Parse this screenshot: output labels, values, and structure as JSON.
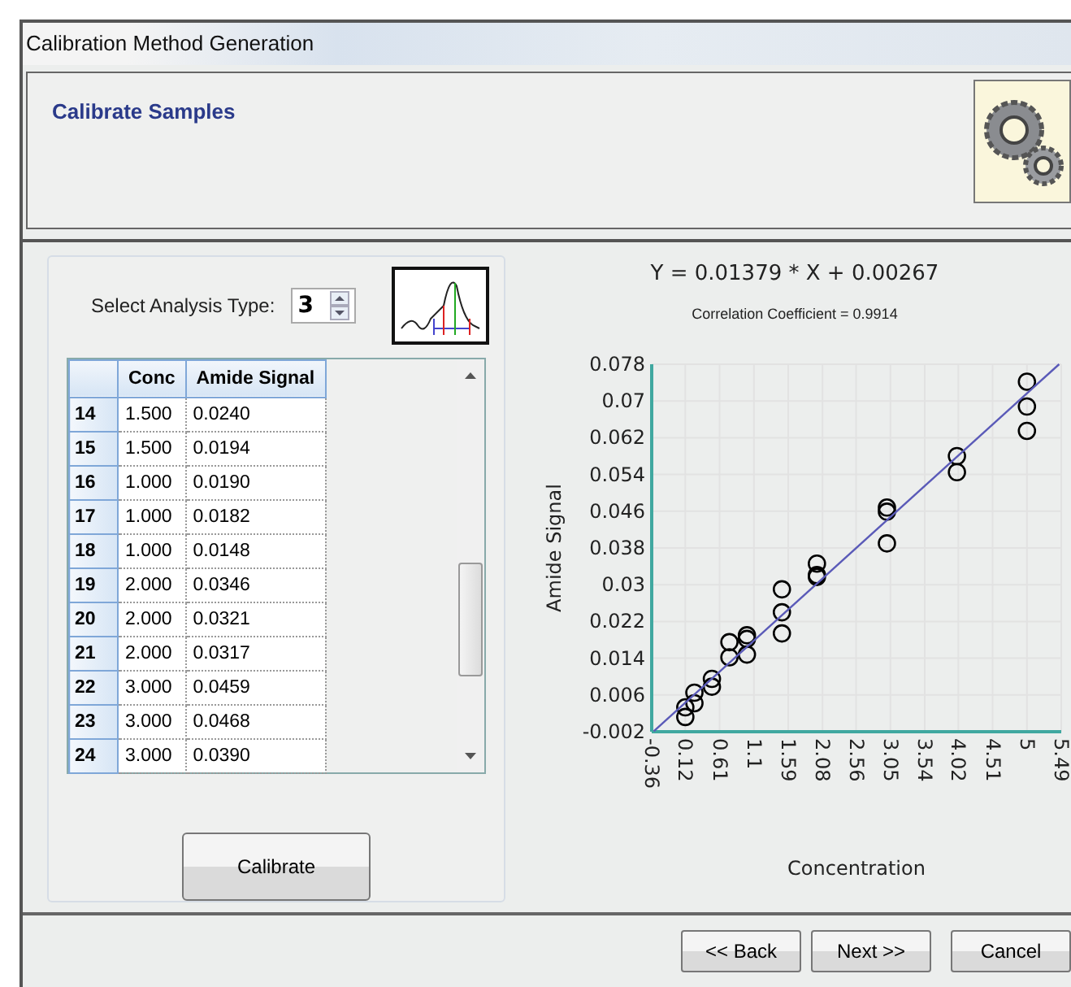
{
  "window": {
    "title": "Calibration Method Generation"
  },
  "header": {
    "title": "Calibrate Samples"
  },
  "analysis": {
    "label": "Select Analysis Type:",
    "value": "3"
  },
  "table": {
    "columns": [
      "",
      "Conc",
      "Amide Signal"
    ],
    "rows": [
      [
        "14",
        "1.500",
        "0.0240"
      ],
      [
        "15",
        "1.500",
        "0.0194"
      ],
      [
        "16",
        "1.000",
        "0.0190"
      ],
      [
        "17",
        "1.000",
        "0.0182"
      ],
      [
        "18",
        "1.000",
        "0.0148"
      ],
      [
        "19",
        "2.000",
        "0.0346"
      ],
      [
        "20",
        "2.000",
        "0.0321"
      ],
      [
        "21",
        "2.000",
        "0.0317"
      ],
      [
        "22",
        "3.000",
        "0.0459"
      ],
      [
        "23",
        "3.000",
        "0.0468"
      ],
      [
        "24",
        "3.000",
        "0.0390"
      ]
    ]
  },
  "calibrate_button": "Calibrate",
  "equation": "Y = 0.01379 * X + 0.00267",
  "correlation": "Correlation Coefficient = 0.9914",
  "chart_data": {
    "type": "scatter",
    "grid": true,
    "xlabel": "Concentration",
    "ylabel": "Amide Signal",
    "xlim": [
      -0.36,
      5.49
    ],
    "ylim": [
      -0.002,
      0.078
    ],
    "xticks": [
      -0.36,
      0.12,
      0.61,
      1.1,
      1.59,
      2.08,
      2.56,
      3.05,
      3.54,
      4.02,
      4.51,
      5,
      5.49
    ],
    "yticks": [
      -0.002,
      0.006,
      0.014,
      0.022,
      0.03,
      0.038,
      0.046,
      0.054,
      0.062,
      0.07,
      0.078
    ],
    "series": [
      {
        "type": "scatter",
        "color": "#000000",
        "x": [
          0.12,
          0.12,
          0.25,
          0.25,
          0.5,
          0.5,
          0.75,
          0.75,
          1,
          1,
          1,
          1.5,
          1.5,
          1.5,
          2,
          2,
          2,
          3,
          3,
          3,
          4,
          4,
          5,
          5,
          5
        ],
        "values": [
          0.0033,
          0.0012,
          0.0065,
          0.0042,
          0.0078,
          0.0095,
          0.0175,
          0.0142,
          0.019,
          0.0182,
          0.0148,
          0.029,
          0.024,
          0.0194,
          0.0346,
          0.0321,
          0.0317,
          0.0459,
          0.0468,
          0.039,
          0.058,
          0.0545,
          0.0742,
          0.0688,
          0.0635
        ]
      },
      {
        "type": "line",
        "color": "#5a5ab8",
        "x": [
          -0.33,
          5.46
        ],
        "values": [
          -0.0019,
          0.078
        ]
      }
    ]
  },
  "buttons": [
    "<< Back",
    "Next >>",
    "Cancel"
  ]
}
